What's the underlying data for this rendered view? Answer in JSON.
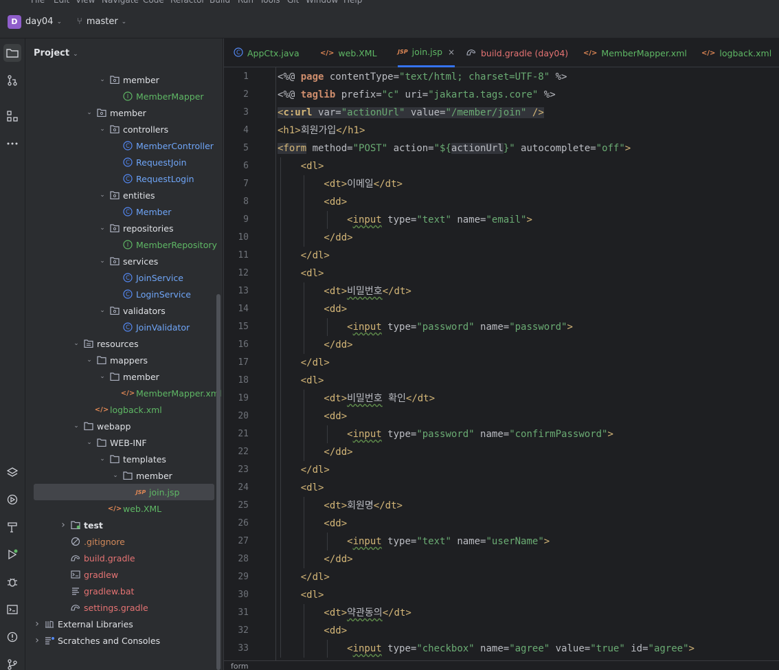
{
  "menubar": {
    "items": [
      "File",
      "Edit",
      "View",
      "Navigate",
      "Code",
      "Refactor",
      "Build",
      "Run",
      "Tools",
      "Git",
      "Window",
      "Help"
    ]
  },
  "toolbar": {
    "project_badge": "D",
    "project_name": "day04",
    "branch": "master"
  },
  "project_panel": {
    "title": "Project",
    "tree": [
      {
        "indent": 5,
        "arrow": "down",
        "icon": "package",
        "label": "member",
        "color": "white"
      },
      {
        "indent": 6,
        "arrow": "",
        "icon": "interface",
        "label": "MemberMapper",
        "color": "green"
      },
      {
        "indent": 4,
        "arrow": "down",
        "icon": "package",
        "label": "member",
        "color": "white"
      },
      {
        "indent": 5,
        "arrow": "down",
        "icon": "package",
        "label": "controllers",
        "color": "white"
      },
      {
        "indent": 6,
        "arrow": "",
        "icon": "class",
        "label": "MemberController",
        "color": "blue"
      },
      {
        "indent": 6,
        "arrow": "",
        "icon": "class",
        "label": "RequestJoin",
        "color": "blue"
      },
      {
        "indent": 6,
        "arrow": "",
        "icon": "class",
        "label": "RequestLogin",
        "color": "blue"
      },
      {
        "indent": 5,
        "arrow": "down",
        "icon": "package",
        "label": "entities",
        "color": "white"
      },
      {
        "indent": 6,
        "arrow": "",
        "icon": "class",
        "label": "Member",
        "color": "blue"
      },
      {
        "indent": 5,
        "arrow": "down",
        "icon": "package",
        "label": "repositories",
        "color": "white"
      },
      {
        "indent": 6,
        "arrow": "",
        "icon": "interface",
        "label": "MemberRepository",
        "color": "green"
      },
      {
        "indent": 5,
        "arrow": "down",
        "icon": "package",
        "label": "services",
        "color": "white"
      },
      {
        "indent": 6,
        "arrow": "",
        "icon": "class",
        "label": "JoinService",
        "color": "blue"
      },
      {
        "indent": 6,
        "arrow": "",
        "icon": "class",
        "label": "LoginService",
        "color": "blue"
      },
      {
        "indent": 5,
        "arrow": "down",
        "icon": "package",
        "label": "validators",
        "color": "white"
      },
      {
        "indent": 6,
        "arrow": "",
        "icon": "class",
        "label": "JoinValidator",
        "color": "blue"
      },
      {
        "indent": 3,
        "arrow": "down",
        "icon": "resources",
        "label": "resources",
        "color": "white"
      },
      {
        "indent": 4,
        "arrow": "down",
        "icon": "folder",
        "label": "mappers",
        "color": "white"
      },
      {
        "indent": 5,
        "arrow": "down",
        "icon": "folder",
        "label": "member",
        "color": "white"
      },
      {
        "indent": 6,
        "arrow": "",
        "icon": "xml",
        "label": "MemberMapper.xml",
        "color": "green"
      },
      {
        "indent": 4,
        "arrow": "",
        "icon": "xml",
        "label": "logback.xml",
        "color": "green"
      },
      {
        "indent": 3,
        "arrow": "down",
        "icon": "folder",
        "label": "webapp",
        "color": "white"
      },
      {
        "indent": 4,
        "arrow": "down",
        "icon": "folder",
        "label": "WEB-INF",
        "color": "white"
      },
      {
        "indent": 5,
        "arrow": "down",
        "icon": "folder",
        "label": "templates",
        "color": "white"
      },
      {
        "indent": 6,
        "arrow": "down",
        "icon": "folder",
        "label": "member",
        "color": "white"
      },
      {
        "indent": 7,
        "arrow": "",
        "icon": "jsp",
        "label": "join.jsp",
        "color": "green",
        "selected": true
      },
      {
        "indent": 5,
        "arrow": "",
        "icon": "xmlweb",
        "label": "web.XML",
        "color": "green"
      },
      {
        "indent": 2,
        "arrow": "right",
        "icon": "testfolder",
        "label": "test",
        "color": "white",
        "bold": true
      },
      {
        "indent": 2,
        "arrow": "",
        "icon": "ignore",
        "label": ".gitignore",
        "color": "orange"
      },
      {
        "indent": 2,
        "arrow": "",
        "icon": "gradle",
        "label": "build.gradle",
        "color": "red"
      },
      {
        "indent": 2,
        "arrow": "",
        "icon": "terminal",
        "label": "gradlew",
        "color": "red"
      },
      {
        "indent": 2,
        "arrow": "",
        "icon": "text",
        "label": "gradlew.bat",
        "color": "red"
      },
      {
        "indent": 2,
        "arrow": "",
        "icon": "gradle",
        "label": "settings.gradle",
        "color": "red"
      },
      {
        "indent": 0,
        "arrow": "right",
        "icon": "library",
        "label": "External Libraries",
        "color": "white"
      },
      {
        "indent": 0,
        "arrow": "right",
        "icon": "scratch",
        "label": "Scratches and Consoles",
        "color": "white"
      }
    ]
  },
  "tabs": [
    {
      "label": "AppCtx.java",
      "icon": "class",
      "color": "#5fb865",
      "active": false,
      "close": false
    },
    {
      "label": "web.XML",
      "icon": "xml",
      "color": "#5fb865",
      "active": false,
      "close": false
    },
    {
      "label": "join.jsp",
      "icon": "jsp",
      "color": "#5fb865",
      "active": true,
      "close": true
    },
    {
      "label": "build.gradle (day04)",
      "icon": "gradle",
      "color": "#e57373",
      "active": false,
      "close": false
    },
    {
      "label": "MemberMapper.xml",
      "icon": "xml",
      "color": "#5fb865",
      "active": false,
      "close": false
    },
    {
      "label": "logback.xml",
      "icon": "xml",
      "color": "#5fb865",
      "active": false,
      "close": false
    }
  ],
  "icons": {
    "xml": "</>",
    "jsp": "JSP",
    "class": "C",
    "interface": "I",
    "close": "×",
    "chevron_down": "⌄",
    "branch": "⑂",
    "arrow_down": "⌄",
    "arrow_right": "›"
  },
  "editor": {
    "lines": [
      [
        {
          "t": "<%@ ",
          "c": "t-txt"
        },
        {
          "t": "page",
          "c": "t-dir"
        },
        {
          "t": " contentType=",
          "c": "t-attr"
        },
        {
          "t": "\"text/html; charset=UTF-8\"",
          "c": "t-str"
        },
        {
          "t": " %>",
          "c": "t-txt"
        }
      ],
      [
        {
          "t": "<%@ ",
          "c": "t-txt"
        },
        {
          "t": "taglib",
          "c": "t-dir"
        },
        {
          "t": " prefix=",
          "c": "t-attr"
        },
        {
          "t": "\"c\"",
          "c": "t-str"
        },
        {
          "t": " uri=",
          "c": "t-attr"
        },
        {
          "t": "\"jakarta.tags.core\"",
          "c": "t-str"
        },
        {
          "t": " %>",
          "c": "t-txt"
        }
      ],
      [
        {
          "t": "<",
          "c": "t-tag t-hl"
        },
        {
          "t": "c:url",
          "c": "t-tag t-hl c-bold"
        },
        {
          "t": " var=",
          "c": "t-attr t-hl"
        },
        {
          "t": "\"actionUrl\"",
          "c": "t-str t-hl"
        },
        {
          "t": " value=",
          "c": "t-attr t-hl"
        },
        {
          "t": "\"/member/join\"",
          "c": "t-str t-hl"
        },
        {
          "t": " />",
          "c": "t-tag t-hl"
        }
      ],
      [
        {
          "t": "<h1>",
          "c": "t-tag"
        },
        {
          "t": "회원가입",
          "c": "t-txt"
        },
        {
          "t": "</h1>",
          "c": "t-tag"
        }
      ],
      [
        {
          "t": "<form",
          "c": "t-tag t-hl"
        },
        {
          "t": " method=",
          "c": "t-attr"
        },
        {
          "t": "\"POST\"",
          "c": "t-str"
        },
        {
          "t": " action=",
          "c": "t-attr"
        },
        {
          "t": "\"${",
          "c": "t-str"
        },
        {
          "t": "actionUrl",
          "c": "t-attr t-hl"
        },
        {
          "t": "}\"",
          "c": "t-str"
        },
        {
          "t": " autocomplete=",
          "c": "t-attr"
        },
        {
          "t": "\"off\"",
          "c": "t-str"
        },
        {
          "t": ">",
          "c": "t-tag"
        }
      ],
      [
        {
          "t": "    <dl>",
          "c": "t-tag"
        }
      ],
      [
        {
          "t": "        <dt>",
          "c": "t-tag"
        },
        {
          "t": "이메일",
          "c": "t-txt"
        },
        {
          "t": "</dt>",
          "c": "t-tag"
        }
      ],
      [
        {
          "t": "        <dd>",
          "c": "t-tag"
        }
      ],
      [
        {
          "t": "            <",
          "c": "t-tag"
        },
        {
          "t": "input",
          "c": "t-tag t-squig"
        },
        {
          "t": " type=",
          "c": "t-attr"
        },
        {
          "t": "\"text\"",
          "c": "t-str"
        },
        {
          "t": " name=",
          "c": "t-attr"
        },
        {
          "t": "\"email\"",
          "c": "t-str"
        },
        {
          "t": ">",
          "c": "t-tag"
        }
      ],
      [
        {
          "t": "        </dd>",
          "c": "t-tag"
        }
      ],
      [
        {
          "t": "    </dl>",
          "c": "t-tag"
        }
      ],
      [
        {
          "t": "    <dl>",
          "c": "t-tag"
        }
      ],
      [
        {
          "t": "        <dt>",
          "c": "t-tag"
        },
        {
          "t": "비밀번호",
          "c": "t-txt t-squig"
        },
        {
          "t": "</dt>",
          "c": "t-tag"
        }
      ],
      [
        {
          "t": "        <dd>",
          "c": "t-tag"
        }
      ],
      [
        {
          "t": "            <",
          "c": "t-tag"
        },
        {
          "t": "input",
          "c": "t-tag t-squig"
        },
        {
          "t": " type=",
          "c": "t-attr"
        },
        {
          "t": "\"password\"",
          "c": "t-str"
        },
        {
          "t": " name=",
          "c": "t-attr"
        },
        {
          "t": "\"password\"",
          "c": "t-str"
        },
        {
          "t": ">",
          "c": "t-tag"
        }
      ],
      [
        {
          "t": "        </dd>",
          "c": "t-tag"
        }
      ],
      [
        {
          "t": "    </dl>",
          "c": "t-tag"
        }
      ],
      [
        {
          "t": "    <dl>",
          "c": "t-tag"
        }
      ],
      [
        {
          "t": "        <dt>",
          "c": "t-tag"
        },
        {
          "t": "비밀번호",
          "c": "t-txt t-squig"
        },
        {
          "t": " 확인",
          "c": "t-txt"
        },
        {
          "t": "</dt>",
          "c": "t-tag"
        }
      ],
      [
        {
          "t": "        <dd>",
          "c": "t-tag"
        }
      ],
      [
        {
          "t": "            <",
          "c": "t-tag"
        },
        {
          "t": "input",
          "c": "t-tag t-squig"
        },
        {
          "t": " type=",
          "c": "t-attr"
        },
        {
          "t": "\"password\"",
          "c": "t-str"
        },
        {
          "t": " name=",
          "c": "t-attr"
        },
        {
          "t": "\"confirmPassword\"",
          "c": "t-str"
        },
        {
          "t": ">",
          "c": "t-tag"
        }
      ],
      [
        {
          "t": "        </dd>",
          "c": "t-tag"
        }
      ],
      [
        {
          "t": "    </dl>",
          "c": "t-tag"
        }
      ],
      [
        {
          "t": "    <dl>",
          "c": "t-tag"
        }
      ],
      [
        {
          "t": "        <dt>",
          "c": "t-tag"
        },
        {
          "t": "회원명",
          "c": "t-txt"
        },
        {
          "t": "</dt>",
          "c": "t-tag"
        }
      ],
      [
        {
          "t": "        <dd>",
          "c": "t-tag"
        }
      ],
      [
        {
          "t": "            <",
          "c": "t-tag"
        },
        {
          "t": "input",
          "c": "t-tag t-squig"
        },
        {
          "t": " type=",
          "c": "t-attr"
        },
        {
          "t": "\"text\"",
          "c": "t-str"
        },
        {
          "t": " name=",
          "c": "t-attr"
        },
        {
          "t": "\"userName\"",
          "c": "t-str"
        },
        {
          "t": ">",
          "c": "t-tag"
        }
      ],
      [
        {
          "t": "        </dd>",
          "c": "t-tag"
        }
      ],
      [
        {
          "t": "    </dl>",
          "c": "t-tag"
        }
      ],
      [
        {
          "t": "    <dl>",
          "c": "t-tag"
        }
      ],
      [
        {
          "t": "        <dt>",
          "c": "t-tag"
        },
        {
          "t": "약관동의",
          "c": "t-txt t-squig"
        },
        {
          "t": "</dt>",
          "c": "t-tag"
        }
      ],
      [
        {
          "t": "        <dd>",
          "c": "t-tag"
        }
      ],
      [
        {
          "t": "            <",
          "c": "t-tag"
        },
        {
          "t": "input",
          "c": "t-tag t-squig"
        },
        {
          "t": " type=",
          "c": "t-attr"
        },
        {
          "t": "\"checkbox\"",
          "c": "t-str"
        },
        {
          "t": " name=",
          "c": "t-attr"
        },
        {
          "t": "\"agree\"",
          "c": "t-str"
        },
        {
          "t": " value=",
          "c": "t-attr"
        },
        {
          "t": "\"true\"",
          "c": "t-str"
        },
        {
          "t": " id=",
          "c": "t-attr"
        },
        {
          "t": "\"agree\"",
          "c": "t-str"
        },
        {
          "t": ">",
          "c": "t-tag"
        }
      ]
    ],
    "breadcrumb": "form"
  },
  "colors": {
    "accent": "#3574f0",
    "panel_bg": "#2b2d30",
    "editor_bg": "#1e1f22"
  }
}
